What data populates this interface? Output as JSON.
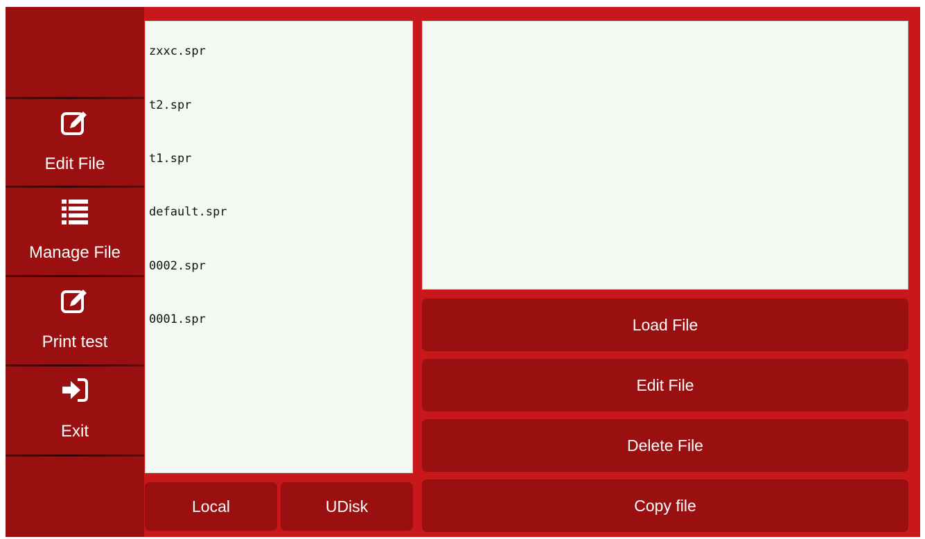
{
  "sidebar": {
    "items": [
      {
        "label": "Edit File",
        "icon": "edit-icon"
      },
      {
        "label": "Manage File",
        "icon": "list-icon"
      },
      {
        "label": "Print  test",
        "icon": "edit-icon"
      },
      {
        "label": "Exit",
        "icon": "sign-in-icon"
      }
    ]
  },
  "files": [
    "zxxc.spr",
    "t2.spr",
    "t1.spr",
    "default.spr",
    "0002.spr",
    "0001.spr"
  ],
  "source_tabs": {
    "local": "Local",
    "udisk": "UDisk"
  },
  "actions": {
    "load": "Load  File",
    "edit": "Edit  File",
    "delete": "Delete  File",
    "copy": "Copy  file"
  },
  "colors": {
    "frame": "#c8181b",
    "panel": "#9a1011",
    "list_bg": "#f4f9f4"
  }
}
